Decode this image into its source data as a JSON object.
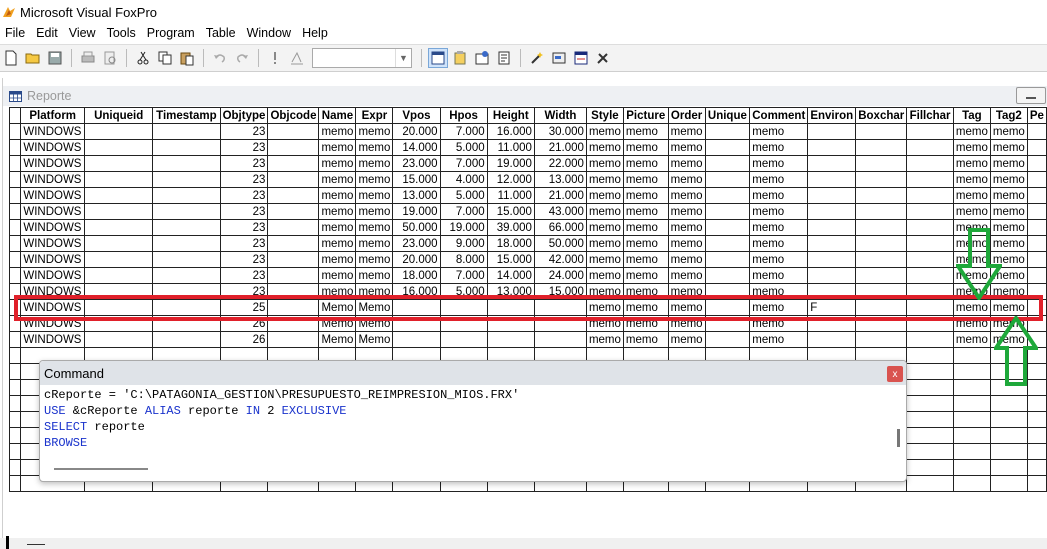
{
  "app": {
    "title": "Microsoft Visual FoxPro"
  },
  "menu": [
    "File",
    "Edit",
    "View",
    "Tools",
    "Program",
    "Table",
    "Window",
    "Help"
  ],
  "toolbar": {
    "combo_value": ""
  },
  "browse": {
    "title": "Reporte",
    "columns": [
      {
        "name": "Platform",
        "w": 64
      },
      {
        "name": "Uniqueid",
        "w": 74
      },
      {
        "name": "Timestamp",
        "w": 68
      },
      {
        "name": "Objtype",
        "w": 48
      },
      {
        "name": "Objcode",
        "w": 51
      },
      {
        "name": "Name",
        "w": 37
      },
      {
        "name": "Expr",
        "w": 34
      },
      {
        "name": "Vpos",
        "w": 50
      },
      {
        "name": "Hpos",
        "w": 50
      },
      {
        "name": "Height",
        "w": 50
      },
      {
        "name": "Width",
        "w": 57
      },
      {
        "name": "Style",
        "w": 34
      },
      {
        "name": "Picture",
        "w": 45
      },
      {
        "name": "Order",
        "w": 35
      },
      {
        "name": "Unique",
        "w": 45
      },
      {
        "name": "Comment",
        "w": 57
      },
      {
        "name": "Environ",
        "w": 48
      },
      {
        "name": "Boxchar",
        "w": 50
      },
      {
        "name": "Fillchar",
        "w": 47
      },
      {
        "name": "Tag",
        "w": 32
      },
      {
        "name": "Tag2",
        "w": 34
      },
      {
        "name": "Pe",
        "w": 17
      }
    ],
    "rows": [
      [
        "WINDOWS",
        "",
        "",
        "23",
        "",
        "memo",
        "memo",
        "20.000",
        "7.000",
        "16.000",
        "30.000",
        "memo",
        "memo",
        "memo",
        "",
        "memo",
        "",
        "",
        "",
        "memo",
        "memo",
        ""
      ],
      [
        "WINDOWS",
        "",
        "",
        "23",
        "",
        "memo",
        "memo",
        "14.000",
        "5.000",
        "11.000",
        "21.000",
        "memo",
        "memo",
        "memo",
        "",
        "memo",
        "",
        "",
        "",
        "memo",
        "memo",
        ""
      ],
      [
        "WINDOWS",
        "",
        "",
        "23",
        "",
        "memo",
        "memo",
        "23.000",
        "7.000",
        "19.000",
        "22.000",
        "memo",
        "memo",
        "memo",
        "",
        "memo",
        "",
        "",
        "",
        "memo",
        "memo",
        ""
      ],
      [
        "WINDOWS",
        "",
        "",
        "23",
        "",
        "memo",
        "memo",
        "15.000",
        "4.000",
        "12.000",
        "13.000",
        "memo",
        "memo",
        "memo",
        "",
        "memo",
        "",
        "",
        "",
        "memo",
        "memo",
        ""
      ],
      [
        "WINDOWS",
        "",
        "",
        "23",
        "",
        "memo",
        "memo",
        "13.000",
        "5.000",
        "11.000",
        "21.000",
        "memo",
        "memo",
        "memo",
        "",
        "memo",
        "",
        "",
        "",
        "memo",
        "memo",
        ""
      ],
      [
        "WINDOWS",
        "",
        "",
        "23",
        "",
        "memo",
        "memo",
        "19.000",
        "7.000",
        "15.000",
        "43.000",
        "memo",
        "memo",
        "memo",
        "",
        "memo",
        "",
        "",
        "",
        "memo",
        "memo",
        ""
      ],
      [
        "WINDOWS",
        "",
        "",
        "23",
        "",
        "memo",
        "memo",
        "50.000",
        "19.000",
        "39.000",
        "66.000",
        "memo",
        "memo",
        "memo",
        "",
        "memo",
        "",
        "",
        "",
        "memo",
        "memo",
        ""
      ],
      [
        "WINDOWS",
        "",
        "",
        "23",
        "",
        "memo",
        "memo",
        "23.000",
        "9.000",
        "18.000",
        "50.000",
        "memo",
        "memo",
        "memo",
        "",
        "memo",
        "",
        "",
        "",
        "memo",
        "memo",
        ""
      ],
      [
        "WINDOWS",
        "",
        "",
        "23",
        "",
        "memo",
        "memo",
        "20.000",
        "8.000",
        "15.000",
        "42.000",
        "memo",
        "memo",
        "memo",
        "",
        "memo",
        "",
        "",
        "",
        "memo",
        "memo",
        ""
      ],
      [
        "WINDOWS",
        "",
        "",
        "23",
        "",
        "memo",
        "memo",
        "18.000",
        "7.000",
        "14.000",
        "24.000",
        "memo",
        "memo",
        "memo",
        "",
        "memo",
        "",
        "",
        "",
        "memo",
        "memo",
        ""
      ],
      [
        "WINDOWS",
        "",
        "",
        "23",
        "",
        "memo",
        "memo",
        "16.000",
        "5.000",
        "13.000",
        "15.000",
        "memo",
        "memo",
        "memo",
        "",
        "memo",
        "",
        "",
        "",
        "memo",
        "memo",
        ""
      ],
      [
        "WINDOWS",
        "",
        "",
        "25",
        "",
        "Memo",
        "Memo",
        "",
        "",
        "",
        "",
        "memo",
        "memo",
        "memo",
        "",
        "memo",
        "F",
        "",
        "",
        "memo",
        "memo",
        ""
      ],
      [
        "WINDOWS",
        "",
        "",
        "26",
        "",
        "Memo",
        "Memo",
        "",
        "",
        "",
        "",
        "memo",
        "memo",
        "memo",
        "",
        "memo",
        "",
        "",
        "",
        "memo",
        "memo",
        ""
      ],
      [
        "WINDOWS",
        "",
        "",
        "26",
        "",
        "Memo",
        "Memo",
        "",
        "",
        "",
        "",
        "memo",
        "memo",
        "memo",
        "",
        "memo",
        "",
        "",
        "",
        "memo",
        "memo",
        ""
      ]
    ],
    "empty_rows": 9
  },
  "command": {
    "title": "Command",
    "close": "x",
    "lines": [
      [
        {
          "t": "cReporte = 'C:\\PATAGONIA_GESTION\\PRESUPUESTO_REIMPRESION_MIOS.FRX'",
          "k": false
        }
      ],
      [
        {
          "t": "USE",
          "k": true
        },
        {
          "t": " &cReporte ",
          "k": false
        },
        {
          "t": "ALIAS",
          "k": true
        },
        {
          "t": " reporte ",
          "k": false
        },
        {
          "t": "IN",
          "k": true
        },
        {
          "t": " 2 ",
          "k": false
        },
        {
          "t": "EXCLUSIVE",
          "k": true
        }
      ],
      [
        {
          "t": "SELECT",
          "k": true
        },
        {
          "t": " reporte",
          "k": false
        }
      ],
      [
        {
          "t": "BROWSE",
          "k": true
        }
      ]
    ]
  }
}
